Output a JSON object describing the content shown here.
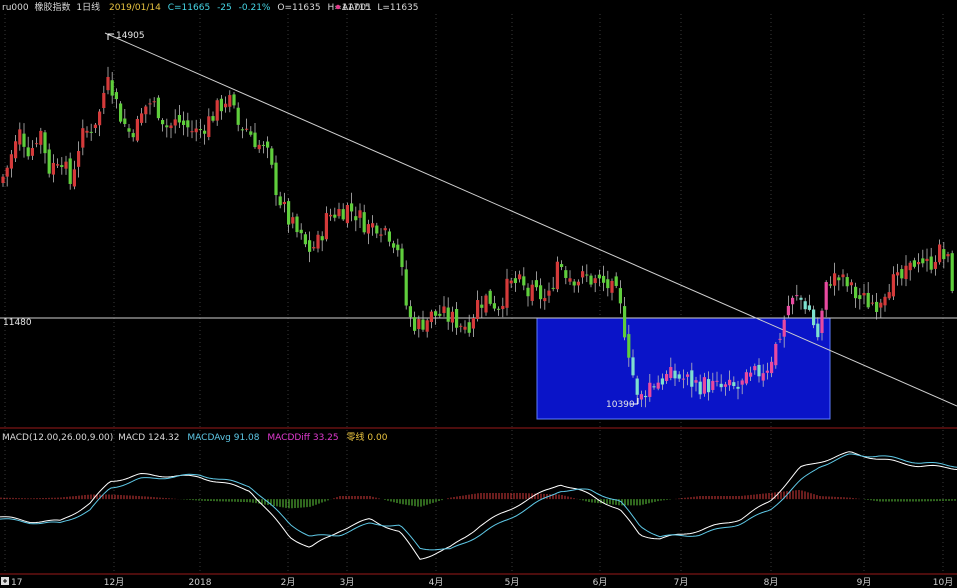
{
  "header": {
    "symbol": "ru000",
    "name": "橡胶指数",
    "period": "1日线",
    "date": "2019/01/14",
    "close": "C=11665",
    "change": "-25",
    "change_pct": "-0.21%",
    "open": "O=11635",
    "high": "H=11715",
    "low": "L=11635",
    "indicator": "AA001"
  },
  "macd": {
    "title": "MACD(12.00,26.00,9.00)",
    "macd": "MACD 124.32",
    "avg": "MACDAvg 91.08",
    "diff": "MACDDiff 33.25",
    "zero": "零线 0.00"
  },
  "annotations": {
    "high_label": "14905",
    "low_label": "10390",
    "level_label": "11480"
  },
  "colors": {
    "up": "#d43a3a",
    "down": "#5fce3c",
    "hist_up": "#d43a3a",
    "hist_down": "#5fce3c",
    "box_fill": "#0a14c8",
    "macd_line": "#ffffff",
    "avg_line": "#5ec8e6",
    "header_date": "#e8c340",
    "header_close": "#46d6e6",
    "header_change": "#46d6e6",
    "header_indicator": "#e03a8a"
  },
  "chart_data": [
    {
      "type": "candlestick",
      "x_ticks": [
        "17",
        "12月",
        "2018",
        "2月",
        "3月",
        "4月",
        "5月",
        "6月",
        "7月",
        "8月",
        "9月",
        "10月"
      ],
      "ylim": [
        10200,
        15300
      ],
      "series": [
        {
          "name": "ru000",
          "close_path": [
            [
              0,
              13250
            ],
            [
              10,
              13550
            ],
            [
              20,
              13900
            ],
            [
              30,
              13650
            ],
            [
              40,
              13950
            ],
            [
              50,
              13400
            ],
            [
              60,
              13650
            ],
            [
              70,
              13250
            ],
            [
              80,
              13800
            ],
            [
              90,
              13950
            ],
            [
              100,
              14150
            ],
            [
              108,
              14700
            ],
            [
              118,
              14200
            ],
            [
              128,
              13900
            ],
            [
              138,
              14000
            ],
            [
              148,
              14300
            ],
            [
              158,
              14200
            ],
            [
              168,
              13950
            ],
            [
              178,
              14050
            ],
            [
              188,
              13950
            ],
            [
              198,
              13900
            ],
            [
              208,
              14050
            ],
            [
              218,
              14200
            ],
            [
              228,
              14350
            ],
            [
              238,
              14000
            ],
            [
              248,
              13950
            ],
            [
              258,
              13750
            ],
            [
              268,
              13600
            ],
            [
              278,
              13100
            ],
            [
              288,
              12800
            ],
            [
              298,
              12600
            ],
            [
              308,
              12400
            ],
            [
              318,
              12500
            ],
            [
              328,
              12850
            ],
            [
              338,
              12900
            ],
            [
              348,
              12950
            ],
            [
              358,
              12850
            ],
            [
              368,
              12700
            ],
            [
              378,
              12750
            ],
            [
              388,
              12650
            ],
            [
              398,
              12450
            ],
            [
              408,
              11550
            ],
            [
              418,
              11450
            ],
            [
              428,
              11550
            ],
            [
              438,
              11600
            ],
            [
              448,
              11550
            ],
            [
              458,
              11500
            ],
            [
              468,
              11450
            ],
            [
              478,
              11750
            ],
            [
              488,
              11800
            ],
            [
              498,
              11700
            ],
            [
              508,
              11950
            ],
            [
              518,
              12000
            ],
            [
              528,
              11850
            ],
            [
              538,
              11850
            ],
            [
              548,
              11750
            ],
            [
              558,
              12300
            ],
            [
              568,
              12100
            ],
            [
              578,
              12050
            ],
            [
              588,
              12050
            ],
            [
              598,
              12000
            ],
            [
              608,
              11950
            ],
            [
              618,
              11800
            ],
            [
              628,
              11200
            ],
            [
              638,
              10450
            ],
            [
              648,
              10700
            ],
            [
              658,
              10750
            ],
            [
              668,
              10800
            ],
            [
              678,
              10800
            ],
            [
              688,
              10750
            ],
            [
              698,
              10700
            ],
            [
              708,
              10700
            ],
            [
              718,
              10650
            ],
            [
              728,
              10650
            ],
            [
              738,
              10650
            ],
            [
              748,
              10750
            ],
            [
              758,
              10850
            ],
            [
              768,
              10950
            ],
            [
              778,
              11250
            ],
            [
              788,
              11700
            ],
            [
              798,
              11800
            ],
            [
              808,
              11700
            ],
            [
              818,
              11300
            ],
            [
              828,
              12050
            ],
            [
              838,
              12050
            ],
            [
              848,
              11950
            ],
            [
              858,
              11800
            ],
            [
              868,
              11750
            ],
            [
              878,
              11750
            ],
            [
              888,
              12000
            ],
            [
              898,
              12000
            ],
            [
              908,
              12100
            ],
            [
              918,
              12350
            ],
            [
              928,
              12200
            ],
            [
              938,
              12400
            ],
            [
              948,
              12250
            ],
            [
              957,
              11665
            ]
          ]
        }
      ]
    },
    {
      "type": "line",
      "title": "MACD(12.00,26.00,9.00)",
      "series": [
        {
          "name": "MACD",
          "points": [
            [
              0,
              -80
            ],
            [
              30,
              -100
            ],
            [
              60,
              -100
            ],
            [
              90,
              -20
            ],
            [
              110,
              80
            ],
            [
              140,
              110
            ],
            [
              200,
              100
            ],
            [
              250,
              40
            ],
            [
              290,
              -170
            ],
            [
              310,
              -220
            ],
            [
              340,
              -140
            ],
            [
              370,
              -90
            ],
            [
              400,
              -150
            ],
            [
              420,
              -270
            ],
            [
              450,
              -220
            ],
            [
              480,
              -120
            ],
            [
              520,
              -20
            ],
            [
              560,
              70
            ],
            [
              590,
              20
            ],
            [
              620,
              -50
            ],
            [
              640,
              -160
            ],
            [
              660,
              -180
            ],
            [
              700,
              -140
            ],
            [
              740,
              -90
            ],
            [
              770,
              -10
            ],
            [
              800,
              140
            ],
            [
              820,
              170
            ],
            [
              850,
              210
            ],
            [
              880,
              180
            ],
            [
              920,
              150
            ],
            [
              957,
              140
            ]
          ]
        },
        {
          "name": "MACDAvg",
          "points": [
            [
              0,
              -90
            ],
            [
              30,
              -105
            ],
            [
              60,
              -110
            ],
            [
              90,
              -50
            ],
            [
              110,
              50
            ],
            [
              140,
              90
            ],
            [
              200,
              110
            ],
            [
              250,
              60
            ],
            [
              290,
              -110
            ],
            [
              310,
              -170
            ],
            [
              340,
              -160
            ],
            [
              370,
              -110
            ],
            [
              400,
              -120
            ],
            [
              420,
              -220
            ],
            [
              450,
              -230
            ],
            [
              480,
              -160
            ],
            [
              520,
              -60
            ],
            [
              560,
              40
            ],
            [
              590,
              40
            ],
            [
              620,
              -10
            ],
            [
              640,
              -120
            ],
            [
              660,
              -170
            ],
            [
              700,
              -160
            ],
            [
              740,
              -110
            ],
            [
              770,
              -50
            ],
            [
              800,
              80
            ],
            [
              820,
              150
            ],
            [
              850,
              200
            ],
            [
              880,
              195
            ],
            [
              920,
              165
            ],
            [
              957,
              150
            ]
          ]
        }
      ]
    }
  ]
}
